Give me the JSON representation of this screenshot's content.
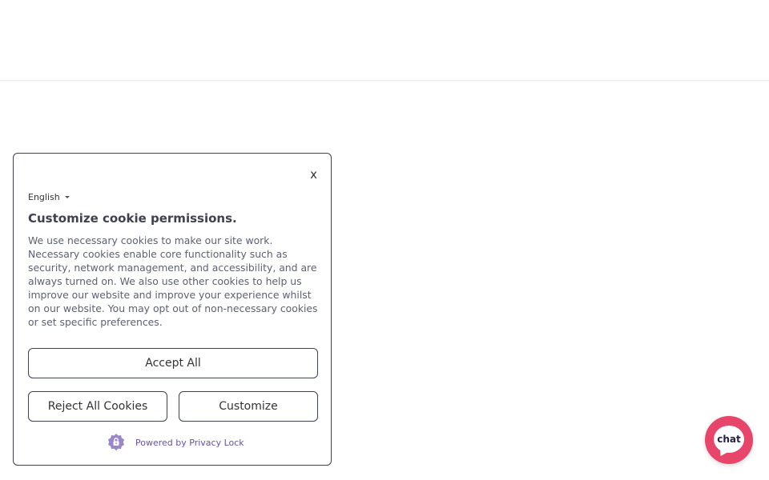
{
  "cookie_banner": {
    "close_label": "x",
    "language": "English",
    "title": "Customize cookie permissions.",
    "body": "We use necessary cookies to make our site work. Necessary cookies enable core functionality such as security, network management, and accessibility, and are always turned on. We also use other cookies to help us improve our website and improve your experience whilst on our website. You may opt out of non-necessary cookies or set specific preferences.",
    "accept_label": "Accept All",
    "reject_label": "Reject All Cookies",
    "customize_label": "Customize",
    "powered_by": "Powered by Privacy Lock",
    "powered_icon": "privacy-lock-icon"
  },
  "chat_widget": {
    "label": "chat",
    "icon": "chat-bubble-icon",
    "color": "#e8456a"
  },
  "colors": {
    "border": "#3d4150",
    "title": "#3d4150",
    "body_text": "#5d6170",
    "brand_purple": "#6b4fa8"
  }
}
